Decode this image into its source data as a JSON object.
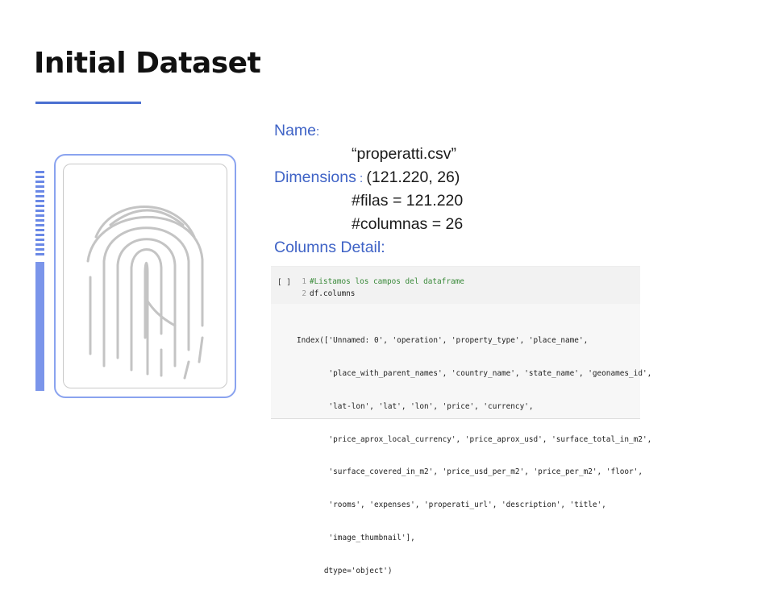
{
  "slide": {
    "title": "Initial Dataset"
  },
  "info": {
    "name_label": "Name",
    "name_colon": ":",
    "file_name": "“properatti.csv”",
    "dimensions_label": "Dimensions",
    "dimensions_colon": " : ",
    "dimensions_value": "(121.220,  26)",
    "rows_line": "#filas = 121.220",
    "cols_line": "#columnas = 26",
    "columns_detail_label": "Columns Detail:"
  },
  "code": {
    "prompt": "[ ]",
    "line1_num": "1",
    "line1_text": "#Listamos los campos del dataframe",
    "line2_num": "2",
    "line2_text": "df.columns",
    "output": [
      "Index(['Unnamed: 0', 'operation', 'property_type', 'place_name',",
      "       'place_with_parent_names', 'country_name', 'state_name', 'geonames_id',",
      "       'lat-lon', 'lat', 'lon', 'price', 'currency',",
      "       'price_aprox_local_currency', 'price_aprox_usd', 'surface_total_in_m2',",
      "       'surface_covered_in_m2', 'price_usd_per_m2', 'price_per_m2', 'floor',",
      "       'rooms', 'expenses', 'properati_url', 'description', 'title',",
      "       'image_thumbnail'],",
      "      dtype='object')"
    ]
  },
  "colors": {
    "accent": "#4a6fd1",
    "label_blue": "#3f63c6",
    "card_border": "#8aa3ef"
  },
  "icons": {
    "fingerprint": "fingerprint-icon"
  }
}
